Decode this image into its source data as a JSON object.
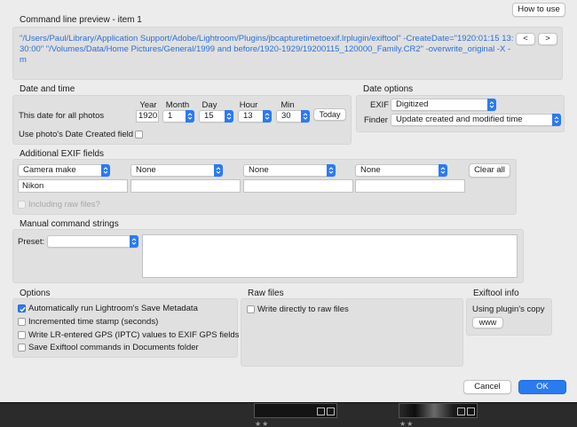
{
  "header": {
    "how_to_use_label": "How to use",
    "preview_title": "Command line preview - item 1",
    "prev_label": "<",
    "next_label": ">",
    "preview_command": "\"/Users/Paul/Library/Application Support/Adobe/Lightroom/Plugins/jbcapturetimetoexif.lrplugin/exiftool\" -CreateDate=\"1920:01:15 13:30:00\"    \"/Volumes/Data/Home Pictures/General/1999 and before/1920-1929/19200115_120000_Family.CR2\" -overwrite_original -X -m"
  },
  "date_time": {
    "section_title": "Date and time",
    "row_label": "This date for all photos",
    "col_year": "Year",
    "col_month": "Month",
    "col_day": "Day",
    "col_hour": "Hour",
    "col_min": "Min",
    "year_value": "1920",
    "month_value": "1",
    "day_value": "15",
    "hour_value": "13",
    "min_value": "30",
    "today_label": "Today",
    "use_created_label": "Use photo's Date Created field"
  },
  "date_options": {
    "section_title": "Date options",
    "exif_label": "EXIF",
    "exif_value": "Digitized",
    "finder_label": "Finder",
    "finder_value": "Update created and modified time"
  },
  "exif_fields": {
    "section_title": "Additional EXIF fields",
    "selects": [
      "Camera make",
      "None",
      "None",
      "None"
    ],
    "values": [
      "Nikon",
      "",
      "",
      ""
    ],
    "clear_all_label": "Clear all",
    "raw_label": "Including raw files?"
  },
  "manual": {
    "section_title": "Manual command strings",
    "preset_label": "Preset:",
    "preset_value": ""
  },
  "options": {
    "section_title": "Options",
    "items": [
      {
        "label": "Automatically run Lightroom's Save Metadata",
        "checked": true
      },
      {
        "label": "Incremented time stamp (seconds)",
        "checked": false
      },
      {
        "label": "Write LR-entered GPS (IPTC) values to EXIF GPS fields",
        "checked": false
      },
      {
        "label": "Save Exiftool commands in Documents folder",
        "checked": false
      }
    ]
  },
  "raw_files": {
    "section_title": "Raw files",
    "write_direct_label": "Write directly to raw files"
  },
  "exiftool_info": {
    "section_title": "Exiftool info",
    "copy_label": "Using plugin's copy",
    "www_label": "www"
  },
  "footer": {
    "cancel_label": "Cancel",
    "ok_label": "OK"
  },
  "filmstrip": {
    "stars_left": "★★",
    "stars_right": "★★"
  },
  "colors": {
    "accent": "#2a7bf0",
    "preview_text": "#2a6fd6"
  }
}
